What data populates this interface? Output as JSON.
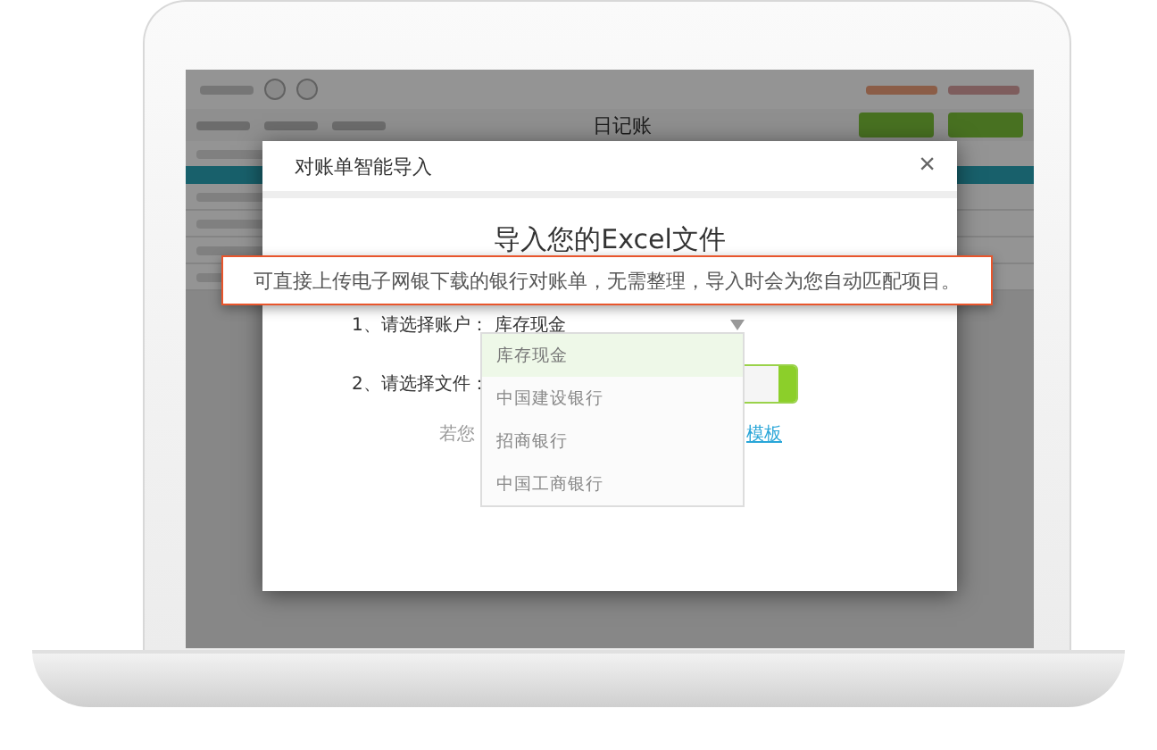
{
  "app": {
    "title": "日记账"
  },
  "dialog": {
    "title": "对账单智能导入",
    "close": "×",
    "heading": "导入您的Excel文件",
    "callout": "可直接上传电子网银下载的银行对账单，无需整理，导入时会为您自动匹配项目。",
    "account_label": "1、请选择账户：",
    "account_value": "库存现金",
    "file_label": "2、请选择文件：",
    "hint_start": "若您",
    "template_link": "模板",
    "account_options": [
      {
        "label": "库存现金",
        "selected": true
      },
      {
        "label": "中国建设银行",
        "selected": false
      },
      {
        "label": "招商银行",
        "selected": false
      },
      {
        "label": "中国工商银行",
        "selected": false
      }
    ]
  }
}
